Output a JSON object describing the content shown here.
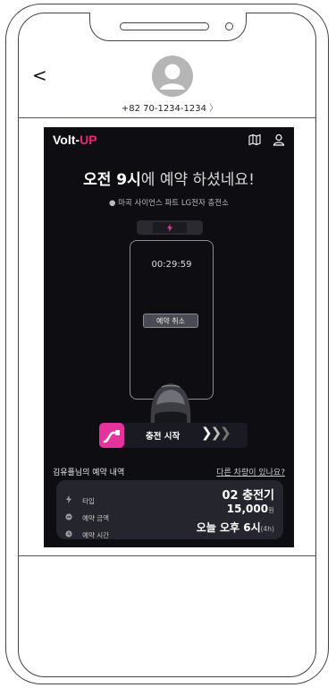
{
  "contact": {
    "back_glyph": "<",
    "phone_number": "+82 70-1234-1234",
    "chevron": "〉"
  },
  "app": {
    "brand_prefix": "Volt-",
    "brand_suffix": "UP",
    "brand_accent": "#e62a7b",
    "icons": [
      "map-icon",
      "user-icon"
    ],
    "headline_bold": "오전 9시",
    "headline_rest": "에 예약 하셨네요!",
    "location": "마곡 사이언스 파트 LG전자 충전소",
    "timer": "00:29:59",
    "cancel_label": "예약 취소",
    "start_label": "충전 시작",
    "start_arrows": [
      "❯",
      "❯",
      "❯"
    ],
    "plug_color": "#e5329c"
  },
  "reservation": {
    "title": "김유플님의 예약 내역",
    "other_car_link": "다른 차량이 있나요?",
    "rows": [
      {
        "icon": "bolt-icon",
        "label": "타입",
        "value": "02 충전기",
        "unit": ""
      },
      {
        "icon": "coin-icon",
        "label": "예약 금액",
        "value": "15,000",
        "unit": "원"
      },
      {
        "icon": "clock-icon",
        "label": "예약 시간",
        "value": "오늘 오후 6시",
        "unit": "(4h)"
      }
    ]
  }
}
